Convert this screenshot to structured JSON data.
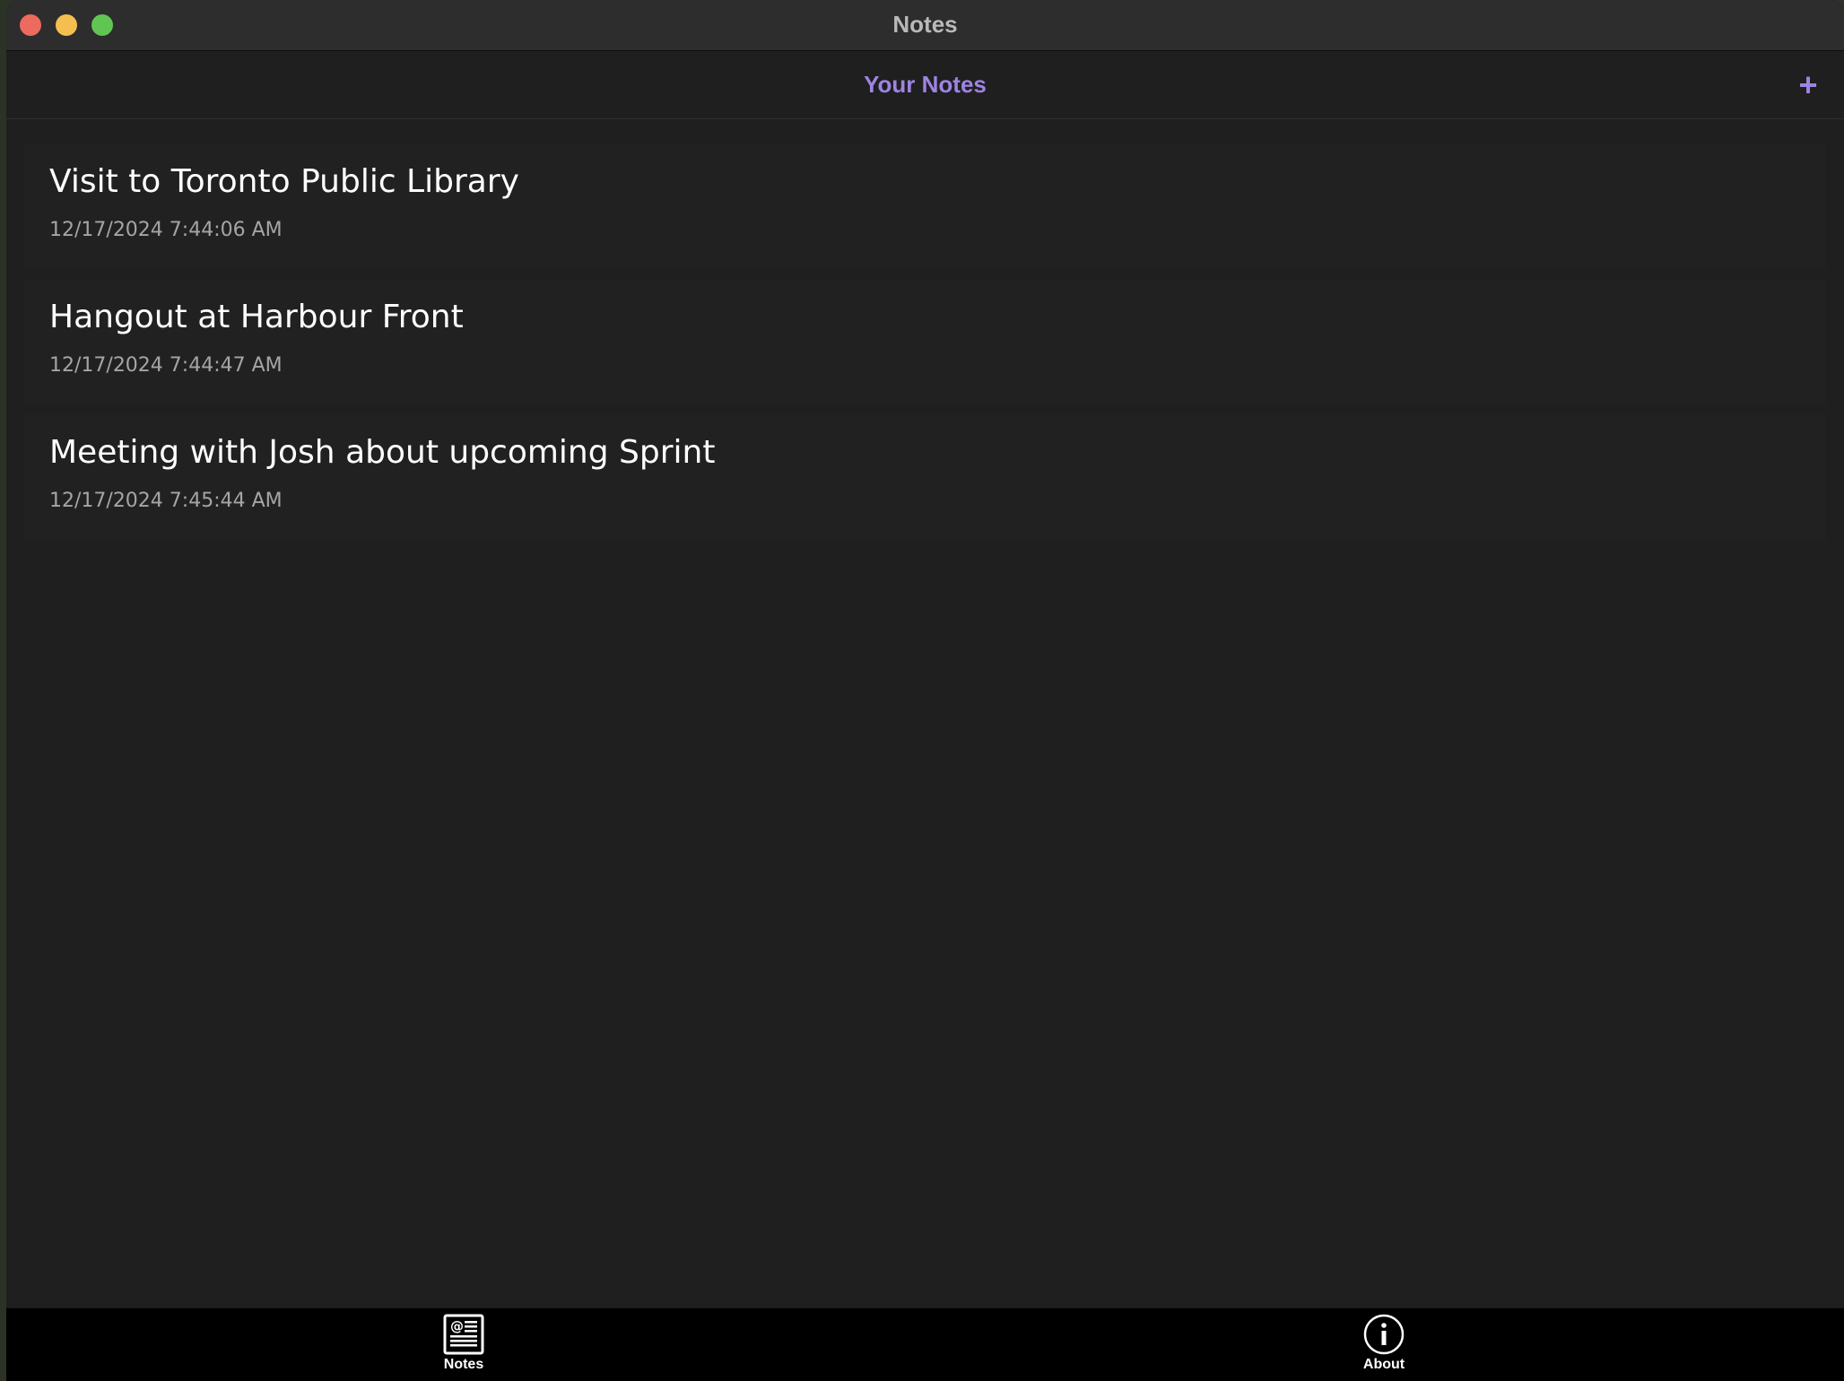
{
  "window": {
    "title": "Notes"
  },
  "navbar": {
    "title": "Your Notes",
    "add_label": "+"
  },
  "notes": [
    {
      "title": "Visit to Toronto Public Library",
      "date": "12/17/2024 7:44:06 AM"
    },
    {
      "title": "Hangout at Harbour Front",
      "date": "12/17/2024 7:44:47 AM"
    },
    {
      "title": "Meeting with Josh about upcoming Sprint",
      "date": "12/17/2024 7:45:44 AM"
    }
  ],
  "tabs": [
    {
      "label": "Notes",
      "icon": "notes-icon"
    },
    {
      "label": "About",
      "icon": "info-icon"
    }
  ],
  "colors": {
    "accent": "#9d84e2",
    "background": "#1f1f1f",
    "tabbar": "#000000"
  }
}
